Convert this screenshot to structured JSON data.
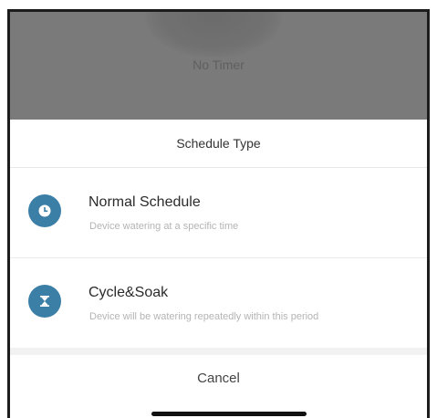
{
  "background": {
    "label": "No Timer"
  },
  "sheet": {
    "title": "Schedule Type",
    "options": [
      {
        "title": "Normal Schedule",
        "subtitle": "Device watering  at a specific time",
        "icon": "clock-icon"
      },
      {
        "title": "Cycle&Soak",
        "subtitle": "Device will be watering repeatedly within this period",
        "icon": "hourglass-icon"
      }
    ],
    "cancel_label": "Cancel"
  },
  "colors": {
    "accent": "#3b7ea6",
    "backdrop": "#7a7a7a"
  }
}
